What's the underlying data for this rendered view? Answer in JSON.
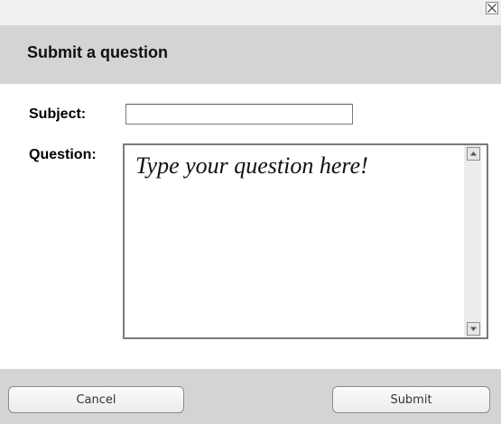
{
  "dialog": {
    "title": "Submit a question",
    "close_icon": "close-x-icon"
  },
  "form": {
    "subject_label": "Subject:",
    "subject_value": "",
    "question_label": "Question:",
    "question_text": "Type your question here!"
  },
  "scrollbar": {
    "up_icon": "arrow-up-icon",
    "down_icon": "arrow-down-icon"
  },
  "footer": {
    "cancel_label": "Cancel",
    "submit_label": "Submit"
  },
  "colors": {
    "titlebar_bg": "#d4d4d4",
    "footer_bg": "#d4d4d4",
    "topbar_bg": "#f0f0f0"
  }
}
